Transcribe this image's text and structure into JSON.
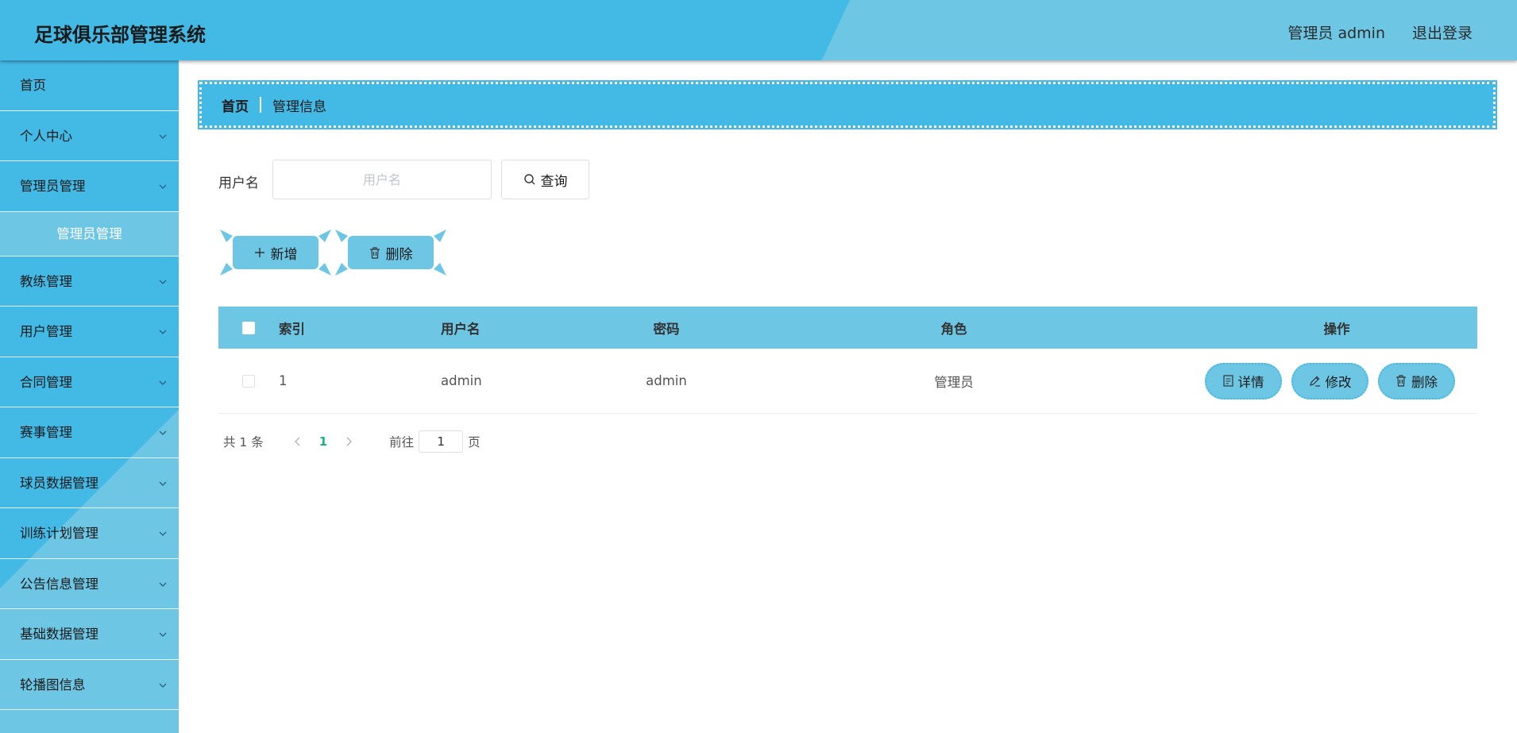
{
  "header": {
    "title": "足球俱乐部管理系统",
    "user": "管理员 admin",
    "logout": "退出登录"
  },
  "sidebar": {
    "items": [
      {
        "label": "首页"
      },
      {
        "label": "个人中心"
      },
      {
        "label": "管理员管理"
      },
      {
        "label": "管理员管理"
      },
      {
        "label": "教练管理"
      },
      {
        "label": "用户管理"
      },
      {
        "label": "合同管理"
      },
      {
        "label": "赛事管理"
      },
      {
        "label": "球员数据管理"
      },
      {
        "label": "训练计划管理"
      },
      {
        "label": "公告信息管理"
      },
      {
        "label": "基础数据管理"
      },
      {
        "label": "轮播图信息"
      }
    ]
  },
  "breadcrumb": {
    "home": "首页",
    "current": "管理信息"
  },
  "search": {
    "label": "用户名",
    "placeholder": "用户名",
    "button": "查询"
  },
  "actions": {
    "add": "新增",
    "delete": "删除"
  },
  "table": {
    "headers": {
      "index": "索引",
      "username": "用户名",
      "password": "密码",
      "role": "角色",
      "ops": "操作"
    },
    "rows": [
      {
        "index": "1",
        "username": "admin",
        "password": "admin",
        "role": "管理员",
        "ops": {
          "detail": "详情",
          "edit": "修改",
          "delete": "删除"
        }
      }
    ]
  },
  "pagination": {
    "total": "共 1 条",
    "current_page": "1",
    "goto_label": "前往",
    "goto_value": "1",
    "page_suffix": "页"
  },
  "colors": {
    "primary": "#43b9e6",
    "light": "#6ec6e5",
    "page_active": "#19b38a"
  }
}
